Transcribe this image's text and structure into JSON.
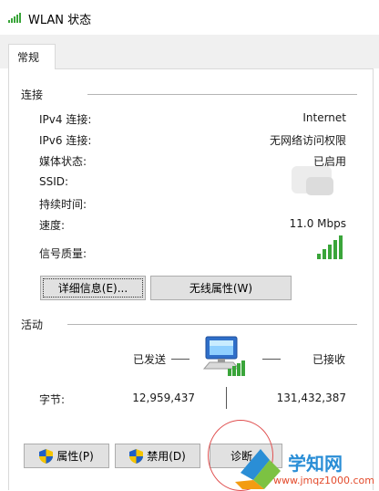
{
  "window": {
    "title": "WLAN 状态",
    "icon": "wifi-signal-icon"
  },
  "tabs": [
    {
      "label": "常规"
    }
  ],
  "connection": {
    "section_label": "连接",
    "rows": [
      {
        "label": "IPv4 连接:",
        "value": "Internet"
      },
      {
        "label": "IPv6 连接:",
        "value": "无网络访问权限"
      },
      {
        "label": "媒体状态:",
        "value": "已启用"
      },
      {
        "label": "SSID:",
        "value": ""
      },
      {
        "label": "持续时间:",
        "value": ""
      },
      {
        "label": "速度:",
        "value": "11.0 Mbps"
      },
      {
        "label": "信号质量:",
        "value": ""
      }
    ],
    "signal_quality_bars": 5,
    "details_button": "详细信息(E)...",
    "wireless_properties_button": "无线属性(W)"
  },
  "activity": {
    "section_label": "活动",
    "sent_label": "已发送",
    "received_label": "已接收",
    "bytes_label": "字节:",
    "bytes_sent": "12,959,437",
    "bytes_received": "131,432,387"
  },
  "buttons": {
    "properties": "属性(P)",
    "disable": "禁用(D)",
    "diagnose": "诊断"
  },
  "watermark": {
    "site": "学知网",
    "url": "www.jmqz1000.com"
  },
  "colors": {
    "signal_green": "#3aa53a",
    "accent_blue": "#2a8ed6",
    "annotation_red": "#e05050"
  }
}
